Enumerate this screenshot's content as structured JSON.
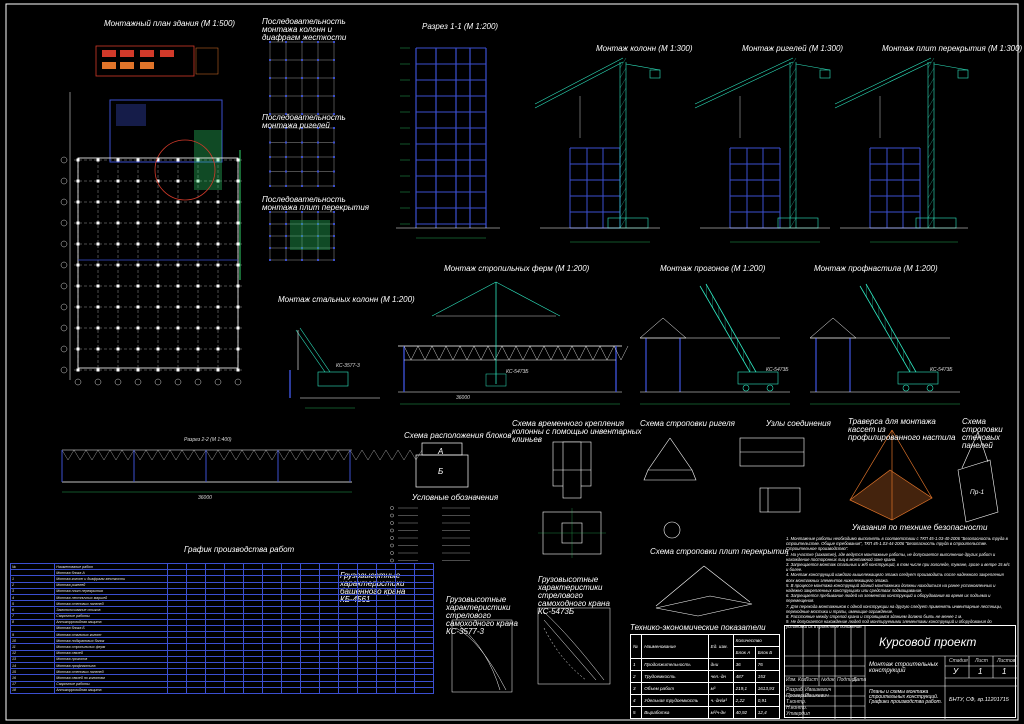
{
  "titles": {
    "plan": "Монтажный план здания (М 1:500)",
    "seq_columns": "Последовательность монтажа колонн и диафрагм жесткости",
    "seq_girders": "Последовательность монтажа ригелей",
    "seq_slabs": "Последовательность монтажа плит перекрытия",
    "section": "Разрез 1-1 (М 1:200)",
    "mount_columns": "Монтаж колонн (М 1:300)",
    "mount_girders": "Монтаж ригелей (М 1:300)",
    "mount_slabs": "Монтаж плит перекрытия (М 1:300)",
    "mount_steel_columns": "Монтаж стальных колонн (М 1:200)",
    "mount_trusses": "Монтаж стропильных ферм (М 1:200)",
    "mount_purlins": "Монтаж прогонов (М 1:200)",
    "mount_decking": "Монтаж профнастила (М 1:200)",
    "section_2_2": "Разрез 2-2 (М 1:400)",
    "blocks_layout": "Схема расположения блоков",
    "legend": "Условные обозначения",
    "temp_fix": "Схема временного крепления колонны с помощью инвентарных клиньев",
    "sling_girder": "Схема строповки ригеля",
    "joints": "Узлы соединения",
    "traverse": "Траверса для монтажа кассет из профилированного настила",
    "sling_wall": "Схема строповки стеновых панелей",
    "safety": "Указания по технике безопасности",
    "sling_slab": "Схема строповки плит перекрытия",
    "works_schedule": "График производства работ",
    "crane_tower": "Грузовысотные характеристики башенного крана КБ-4561",
    "crane_3577": "Грузовысотные характеристики стрелового самоходного крана КС-3577-3",
    "crane_5473": "Грузовысотные характеристики стрелового самоходного крана КС-5473Б",
    "teo": "Технико-экономические показатели"
  },
  "labels": {
    "block_a": "А",
    "block_b": "Б",
    "panel": "Пр-1",
    "dim_section_total": "36000",
    "dim_2_2": "36000",
    "crane_label_1": "КС-3577-3",
    "crane_label_2": "КС-5473Б",
    "crane_label_3": "КС-5473Б",
    "crane_label_4": "КС-5473Б"
  },
  "safety_notes": [
    "1. Монтажные работы необходимо выполнять в соответствии с ТКП 45-1.03-40-2006 \"Безопасность труда в строительстве. Общие требования\", ТКП 45-1.03-44-2006 \"Безопасность труда в строительстве. Строительное производство\".",
    "2. На участке (захватке), где ведутся монтажные работы, не допускается выполнение других работ и нахождение посторонних лиц в монтажной зоне крана.",
    "3. Запрещается монтаж стальных и ж/б конструкций, в том числе при гололеде, тумане, грозе и ветре 15 м/с и более.",
    "4. Монтаж конструкций каждого вышележащего этажа следует производить после надежного закрепления всех монтажных элементов нижележащего этажа.",
    "5. В процессе монтажа конструкций зданий монтажники должны находиться на ранее установленных и надежно закрепленных конструкциях или средствах подмащивания.",
    "6. Запрещается пребывание людей на элементах конструкций и оборудования во время их подъема и перемещения.",
    "7. Для перехода монтажников с одной конструкции на другую следует применять инвентарные лестницы, переходные мостики и трапы, имеющие ограждение.",
    "8. Расстояние между стрелой крана и строящимся зданием должно быть не менее 1 м.",
    "9. Не допускается нахождение людей под монтируемыми элементами конструкций и оборудования до установки их в проектное положение."
  ],
  "teo": {
    "title": "Технико-экономические показатели",
    "headers": [
      "№",
      "Наименование",
      "Ед. изм.",
      "Количество"
    ],
    "sub_headers": [
      "Блок А",
      "Блок Б"
    ],
    "rows": [
      [
        "1",
        "Продолжительность",
        "дни",
        "36",
        "76"
      ],
      [
        "2",
        "Трудоемкость",
        "чел.-дн",
        "487",
        "153"
      ],
      [
        "3",
        "Объем работ",
        "м³",
        "219,1",
        "1613,93"
      ],
      [
        "4",
        "Удельная трудоемкость",
        "ч.-дн/м³",
        "2,22",
        "0,91"
      ],
      [
        "5",
        "Выработка",
        "м³/ч-дн",
        "40,92",
        "12,4"
      ]
    ]
  },
  "stamp": {
    "title": "Курсовой проект",
    "subject": "Монтаж строительных конструкций",
    "sheet_desc": "Планы и схемы монтажа строительных конструкций. Графики производства работ.",
    "org": "БНТУ, СФ, гр.11201715",
    "stage_label": "Стадия",
    "sheet_label": "Лист",
    "sheets_label": "Листов",
    "stage": "У",
    "sheet": "1",
    "sheets": "1",
    "cols": [
      "Изм. Кол.",
      "Лист",
      "№док.",
      "Подпись",
      "Дата"
    ],
    "roles": [
      "Разраб.",
      "Проверил",
      "Т.контр.",
      "Н.контр.",
      "Утвердил"
    ],
    "names": [
      "Ивашкевич",
      "Пашкевич"
    ]
  },
  "gantt": {
    "header": "№",
    "name_header": "Наименование работ",
    "section_a": "Монтаж блока А",
    "section_b": "Монтаж блока Б",
    "rows": [
      "Монтаж колонн и диафрагм жесткости",
      "Монтаж ригелей",
      "Монтаж плит перекрытия",
      "Монтаж лестничных маршей",
      "Монтаж стеновых панелей",
      "Замоноличивание стыков",
      "Сварочные работы",
      "Антикоррозийная защита",
      "Монтаж стальных колонн",
      "Монтаж подкрановых балок",
      "Монтаж стропильных ферм",
      "Монтаж связей",
      "Монтаж прогонов",
      "Монтаж профнастила",
      "Монтаж стеновых панелей",
      "Монтаж связей по колоннам",
      "Сварочные работы",
      "Антикоррозийная защита"
    ]
  },
  "colors": {
    "background": "#000000",
    "lines": "#ffffff",
    "structure": "#3b4fd0",
    "crane": "#2ee6c0",
    "dims": "#2fd36a",
    "accent": "#d23a2a",
    "orange": "#e0742a"
  }
}
